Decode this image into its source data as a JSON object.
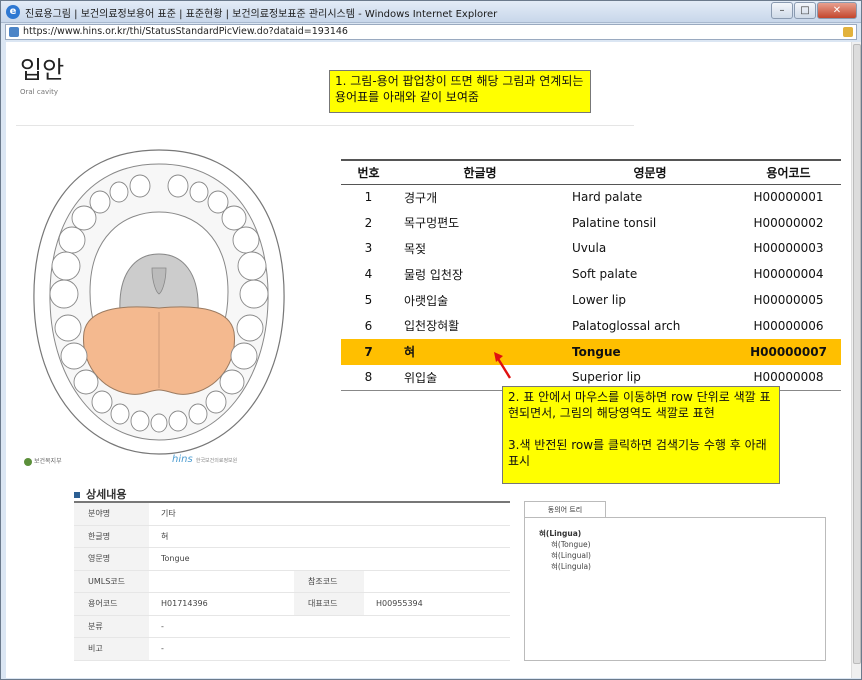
{
  "window": {
    "title": "진료용그림 | 보건의료정보용어 표준 | 표준현황 | 보건의료정보표준 관리시스템 - Windows Internet Explorer",
    "url": "https://www.hins.or.kr/thi/StatusStandardPicView.do?dataid=193146",
    "btn_min": "–",
    "btn_max": "□",
    "btn_close": "✕"
  },
  "page": {
    "title": "입안",
    "subtitle": "Oral cavity"
  },
  "notes": {
    "note1": "1. 그림-용어 팝업창이 뜨면 해당 그림과 연계되는 용어표를 아래와 같이 보여줌",
    "note2_line1": "2. 표 안에서 마우스를 이동하면 row 단위로 색깔 표현되면서, 그림의 해당영역도 색깔로 표현",
    "note2_line2": "3.색 반전된 row를 클릭하면 검색기능 수행 후 아래 표시"
  },
  "terms_table": {
    "headers": {
      "no": "번호",
      "ko": "한글명",
      "en": "영문명",
      "code": "용어코드"
    },
    "rows": [
      {
        "no": "1",
        "ko": "경구개",
        "en": "Hard palate",
        "code": "H00000001"
      },
      {
        "no": "2",
        "ko": "목구멍편도",
        "en": "Palatine tonsil",
        "code": "H00000002"
      },
      {
        "no": "3",
        "ko": "목젖",
        "en": "Uvula",
        "code": "H00000003"
      },
      {
        "no": "4",
        "ko": "물렁 입천장",
        "en": "Soft palate",
        "code": "H00000004"
      },
      {
        "no": "5",
        "ko": "아랫입술",
        "en": "Lower lip",
        "code": "H00000005"
      },
      {
        "no": "6",
        "ko": "입천장혀활",
        "en": "Palatoglossal arch",
        "code": "H00000006"
      },
      {
        "no": "7",
        "ko": "혀",
        "en": "Tongue",
        "code": "H00000007"
      },
      {
        "no": "8",
        "ko": "위입술",
        "en": "Superior lip",
        "code": "H00000008"
      }
    ],
    "highlight_color": "#ffbf00"
  },
  "logos": {
    "ministry": "보건복지부",
    "hins": "hins",
    "hins_sub": "한국보건의료정보원"
  },
  "detail": {
    "heading": "상세내용",
    "rows": {
      "field_label": "분야명",
      "field_value": "기타",
      "ko_label": "한글명",
      "ko_value": "혀",
      "en_label": "영문명",
      "en_value": "Tongue",
      "umls_label": "UMLS코드",
      "umls_value": "",
      "ref_label": "참조코드",
      "ref_value": "",
      "term_code_label": "용어코드",
      "term_code_value": "H01714396",
      "rep_label": "대표코드",
      "rep_value": "H00955394",
      "class_label": "분류",
      "class_value": "-",
      "note_label": "비고",
      "note_value": "-"
    }
  },
  "synonym_tree": {
    "tab": "동의어 트리",
    "root": "혀(Lingua)",
    "children": [
      "혀(Tongue)",
      "혀(Lingual)",
      "혀(Lingula)"
    ]
  },
  "colors": {
    "tongue": "#f4b98f",
    "palate": "#cccccc",
    "note_bg": "#ffff00"
  }
}
